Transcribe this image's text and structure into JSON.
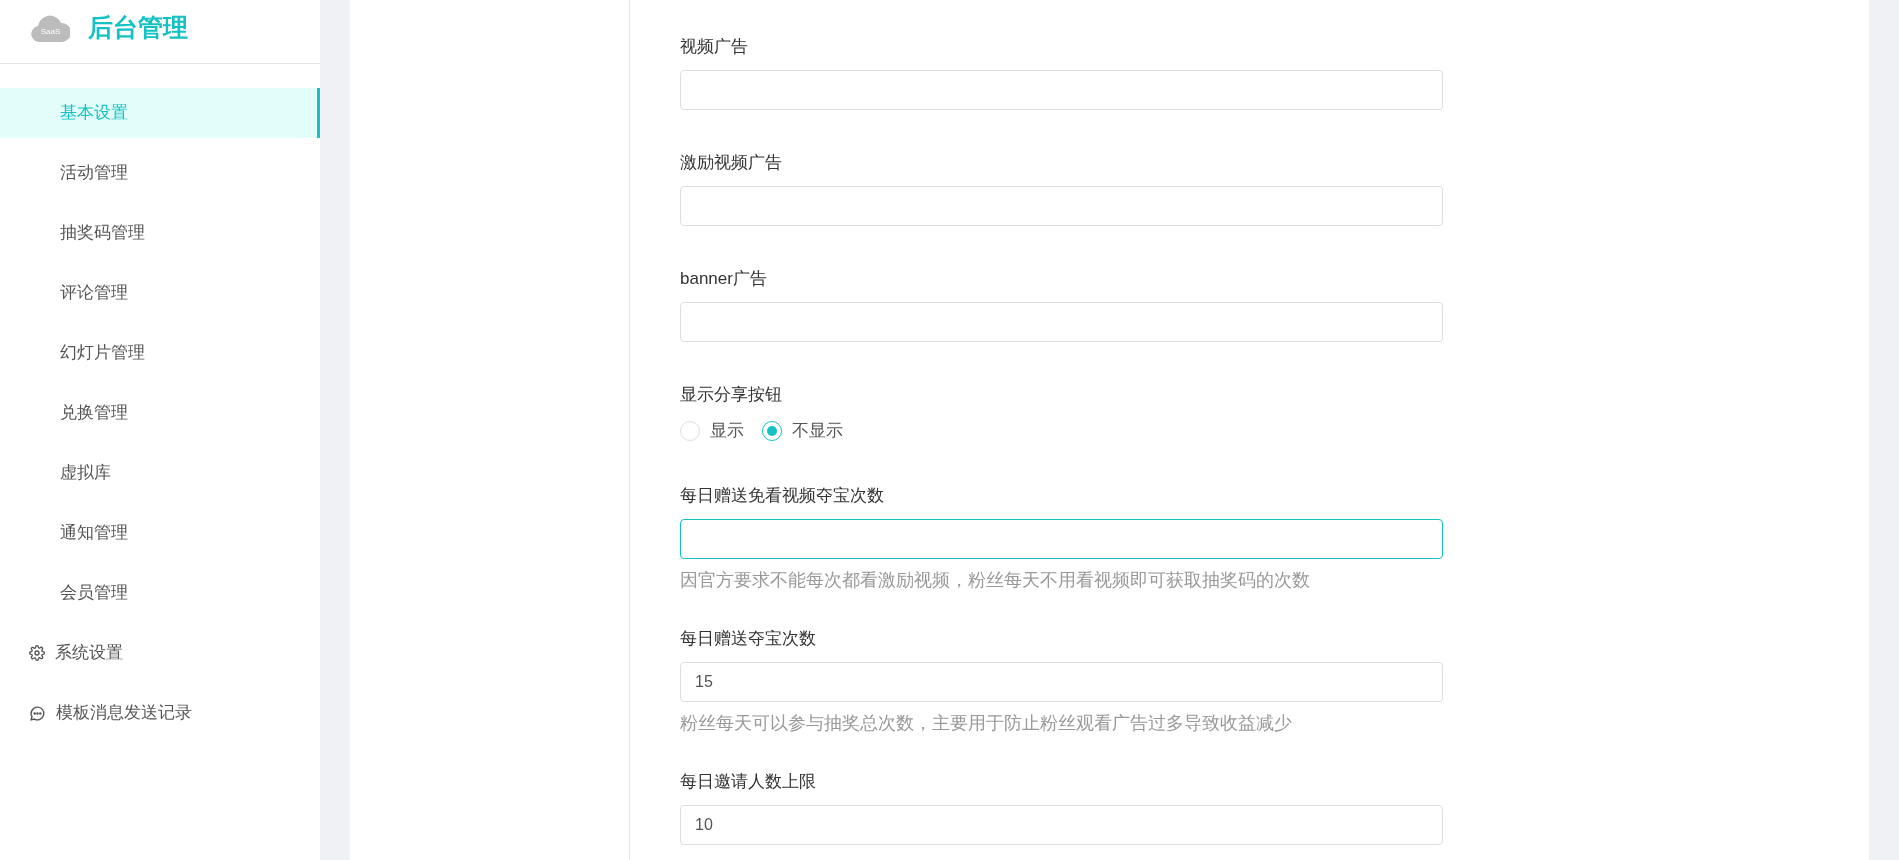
{
  "logo": {
    "badge": "SaaS",
    "title": "后台管理"
  },
  "sidebar": {
    "items": [
      {
        "kind": "plain",
        "label": "基本设置",
        "selected": true
      },
      {
        "kind": "plain",
        "label": "活动管理",
        "selected": false
      },
      {
        "kind": "plain",
        "label": "抽奖码管理",
        "selected": false
      },
      {
        "kind": "plain",
        "label": "评论管理",
        "selected": false
      },
      {
        "kind": "plain",
        "label": "幻灯片管理",
        "selected": false
      },
      {
        "kind": "plain",
        "label": "兑换管理",
        "selected": false
      },
      {
        "kind": "plain",
        "label": "虚拟库",
        "selected": false
      },
      {
        "kind": "plain",
        "label": "通知管理",
        "selected": false
      },
      {
        "kind": "plain",
        "label": "会员管理",
        "selected": false
      },
      {
        "kind": "gear",
        "label": "系统设置",
        "selected": false
      },
      {
        "kind": "chat",
        "label": "模板消息发送记录",
        "selected": false
      }
    ]
  },
  "form": {
    "fields": [
      {
        "kind": "text",
        "label": "视频广告",
        "focused": false
      },
      {
        "kind": "text",
        "label": "激励视频广告",
        "focused": false
      },
      {
        "kind": "text",
        "label": "banner广告",
        "focused": false
      },
      {
        "kind": "radio",
        "label": "显示分享按钮",
        "options": [
          {
            "label": "显示",
            "selected": false
          },
          {
            "label": "不显示",
            "selected": true
          }
        ]
      },
      {
        "kind": "text",
        "label": "每日赠送免看视频夺宝次数",
        "focused": true,
        "help": "因官方要求不能每次都看激励视频，粉丝每天不用看视频即可获取抽奖码的次数"
      },
      {
        "kind": "text",
        "label": "每日赠送夺宝次数",
        "focused": false,
        "value": "15",
        "help": "粉丝每天可以参与抽奖总次数，主要用于防止粉丝观看广告过多导致收益减少"
      },
      {
        "kind": "text",
        "label": "每日邀请人数上限",
        "focused": false,
        "value": "10"
      }
    ]
  }
}
